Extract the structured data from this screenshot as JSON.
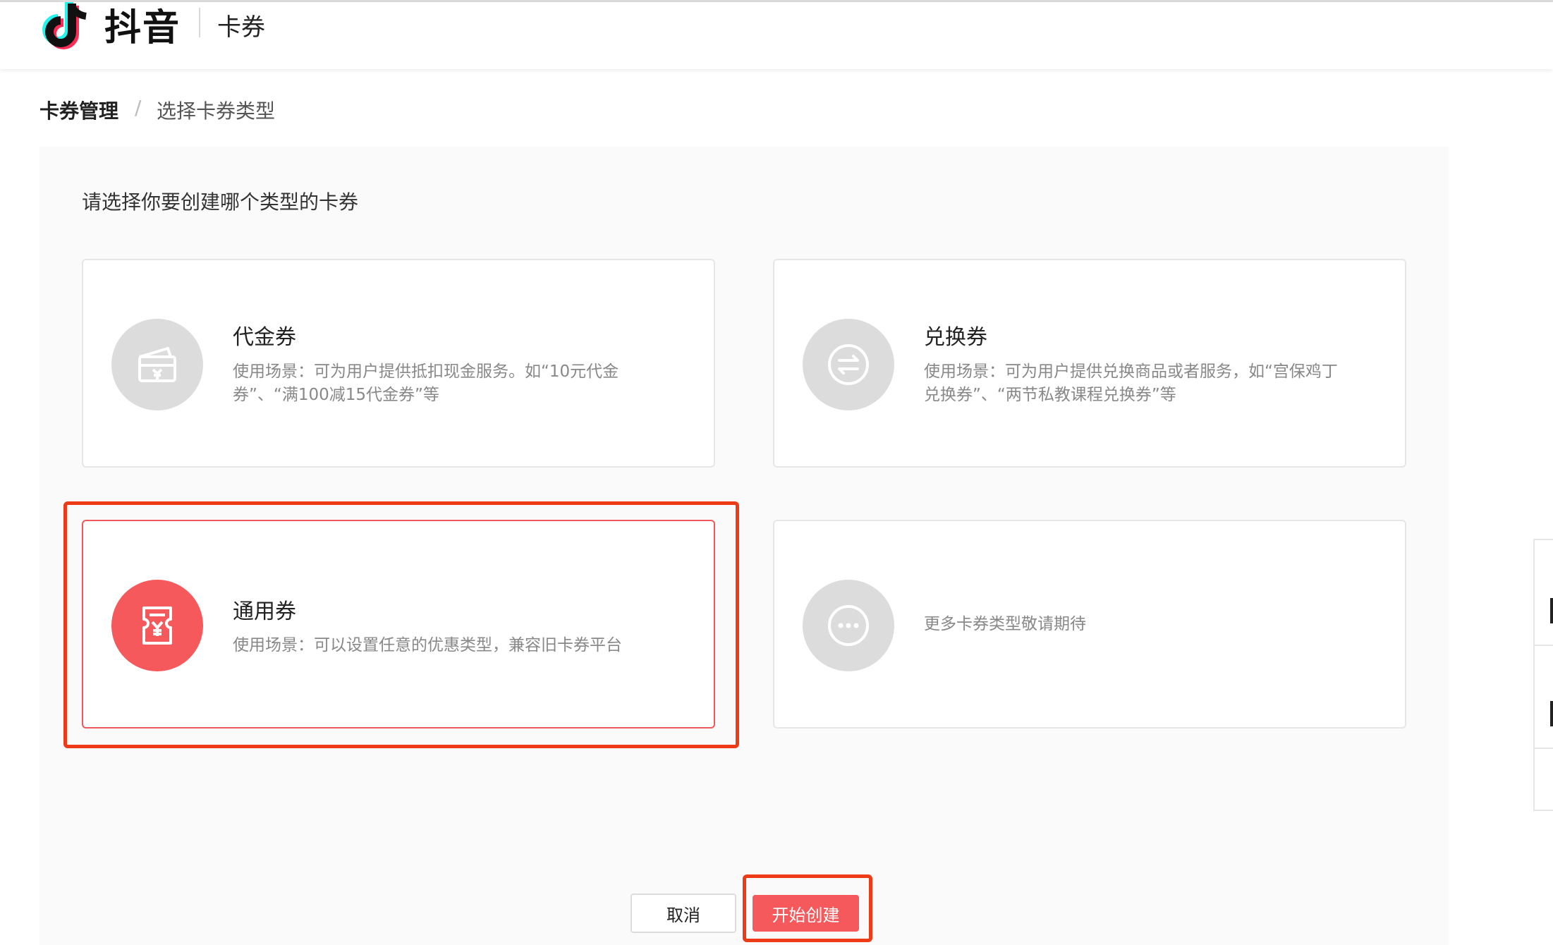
{
  "header": {
    "logo_text": "抖音",
    "title": "卡券",
    "accent_colors": [
      "#25F4EE",
      "#FE2C55",
      "#111111"
    ]
  },
  "breadcrumb": {
    "items": [
      "卡券管理",
      "选择卡券类型"
    ],
    "separator": "/"
  },
  "main": {
    "prompt": "请选择你要创建哪个类型的卡券",
    "cards": [
      {
        "title": "代金券",
        "description": "使用场景：可为用户提供抵扣现金服务。如“10元代金券”、“满100减15代金券”等",
        "icon": "wallet-yen-icon",
        "selected": false
      },
      {
        "title": "兑换券",
        "description": "使用场景：可为用户提供兑换商品或者服务，如“宫保鸡丁兑换券”、“两节私教课程兑换券”等",
        "icon": "exchange-arrows-icon",
        "selected": false
      },
      {
        "title": "通用券",
        "description": "使用场景：可以设置任意的优惠类型，兼容旧卡券平台",
        "icon": "ticket-yen-icon",
        "selected": true
      },
      {
        "title": "",
        "description": "更多卡券类型敬请期待",
        "icon": "more-dots-icon",
        "selected": false
      }
    ]
  },
  "actions": {
    "cancel_label": "取消",
    "create_label": "开始创建"
  },
  "colors": {
    "accent": "#F6595C",
    "highlight_annotation": "#EE3B17",
    "icon_inactive": "#DCDCDC"
  }
}
